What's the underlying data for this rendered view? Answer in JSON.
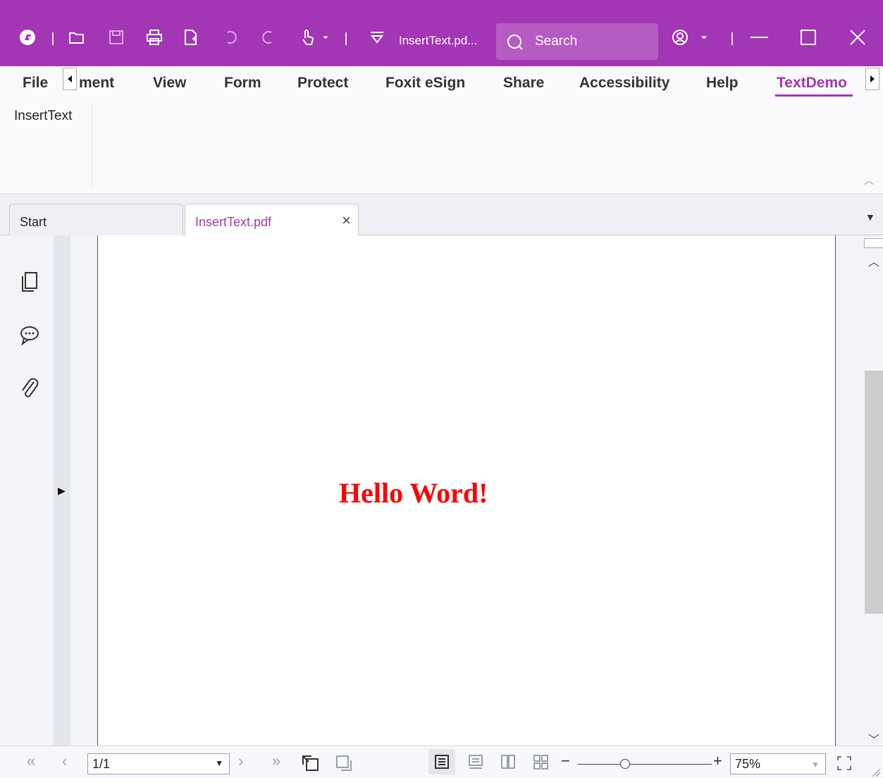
{
  "app": {
    "document_title": "InsertText.pd...",
    "search_placeholder": "Search"
  },
  "menu": {
    "items": [
      {
        "label": "File"
      },
      {
        "label": "ment"
      },
      {
        "label": "View"
      },
      {
        "label": "Form"
      },
      {
        "label": "Protect"
      },
      {
        "label": "Foxit eSign"
      },
      {
        "label": "Share"
      },
      {
        "label": "Accessibility"
      },
      {
        "label": "Help"
      },
      {
        "label": "TextDemo",
        "active": true
      }
    ]
  },
  "ribbon": {
    "insert_text_label": "InsertText"
  },
  "tabs": [
    {
      "label": "Start"
    },
    {
      "label": "InsertText.pdf",
      "active": true
    }
  ],
  "left_panel": {
    "icons": [
      "pages-icon",
      "comments-icon",
      "attachments-icon"
    ]
  },
  "page": {
    "content_text": "Hello Word!",
    "text_color": "#ff0000"
  },
  "statusbar": {
    "page_indicator": "1/1",
    "zoom": "75%"
  },
  "colors": {
    "brand": "#a336b4",
    "search_bg": "#b55bc4"
  }
}
